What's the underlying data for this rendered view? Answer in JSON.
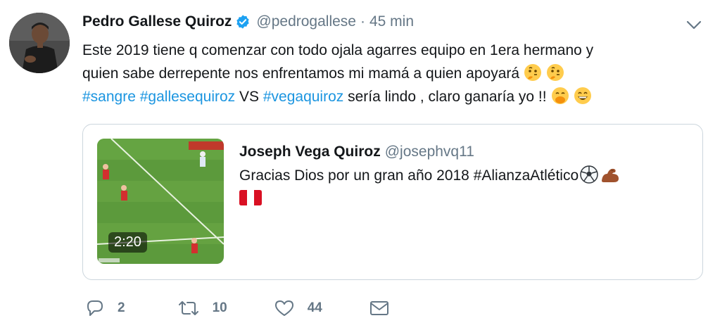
{
  "author": {
    "display_name": "Pedro Gallese Quiroz",
    "handle": "@pedrogallese",
    "separator": "·",
    "time": "45 min",
    "verified": true,
    "avatar_icon": "profile-photo"
  },
  "tweet": {
    "lines": [
      {
        "text": "Este 2019 tiene q comenzar con todo ojala agarres equipo en 1era hermano y"
      },
      {
        "text": "quien sabe derrepente nos enfrentamos mi mamá a quien apoyará"
      }
    ],
    "line3": {
      "tag1": "#sangre",
      "tag2": "#gallesequiroz",
      "vs": " VS ",
      "tag3": "#vegaquiroz",
      "rest": " sería lindo , claro ganaría yo !!"
    },
    "emojis": [
      "thinking-face-emoji",
      "thinking-face-emoji",
      "face-with-hand-over-mouth-emoji",
      "grinning-face-emoji"
    ]
  },
  "quote": {
    "display_name": "Joseph Vega Quiroz",
    "handle": "@josephvq11",
    "text": "Gracias Dios por un gran año 2018 #AlianzaAtlético",
    "emojis": [
      "soccer-ball-emoji",
      "flexed-biceps-emoji",
      "peru-flag-emoji"
    ],
    "video_duration": "2:20"
  },
  "actions": {
    "reply_count": "2",
    "retweet_count": "10",
    "like_count": "44"
  },
  "colors": {
    "link": "#1b95e0",
    "muted": "#657786",
    "text": "#14171a",
    "verified": "#1da1f2",
    "border": "#ccd6dd"
  }
}
